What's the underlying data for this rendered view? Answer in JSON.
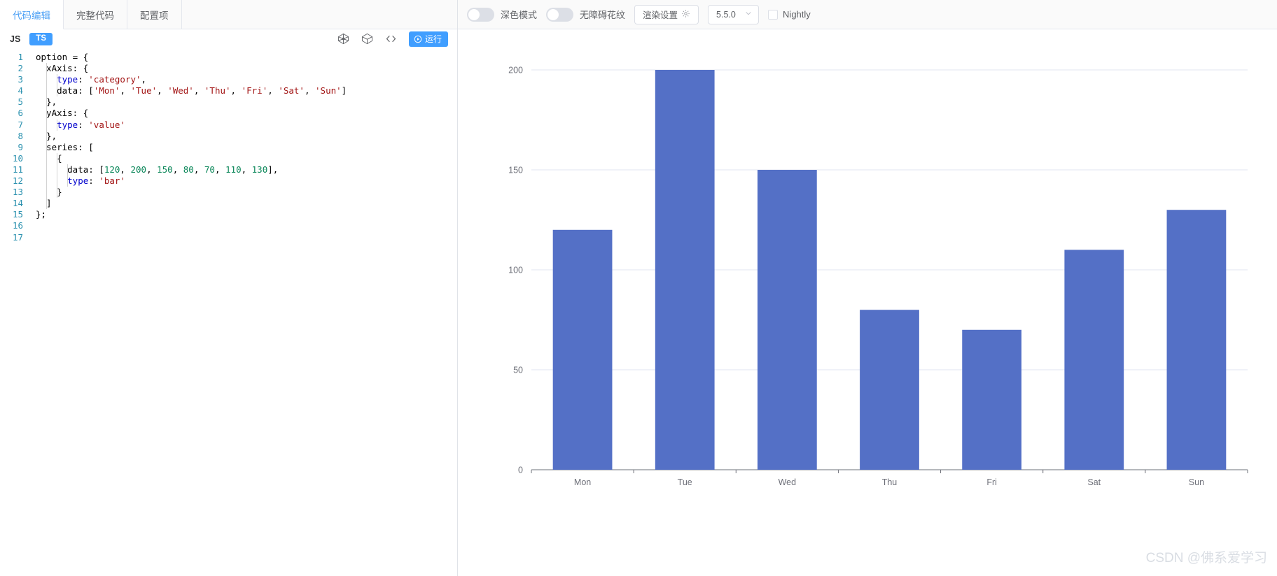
{
  "editor": {
    "tabs": [
      {
        "label": "代码编辑",
        "active": true
      },
      {
        "label": "完整代码",
        "active": false
      },
      {
        "label": "配置项",
        "active": false
      }
    ],
    "lang_js": "JS",
    "lang_ts": "TS",
    "active_lang": "TS",
    "icons": [
      "palette-icon",
      "cube-icon",
      "code-brackets-icon"
    ],
    "run_label": "运行",
    "line_count": 17,
    "line_numbers": [
      "1",
      "2",
      "3",
      "4",
      "5",
      "6",
      "7",
      "8",
      "9",
      "10",
      "11",
      "12",
      "13",
      "14",
      "15",
      "16",
      "17"
    ],
    "code_lines": [
      [
        {
          "t": "option = {",
          "c": "plain"
        }
      ],
      [
        {
          "t": "  xAxis: {",
          "c": "plain"
        }
      ],
      [
        {
          "t": "    ",
          "c": "plain"
        },
        {
          "t": "type",
          "c": "prop"
        },
        {
          "t": ": ",
          "c": "plain"
        },
        {
          "t": "'category'",
          "c": "str"
        },
        {
          "t": ",",
          "c": "plain"
        }
      ],
      [
        {
          "t": "    data: [",
          "c": "plain"
        },
        {
          "t": "'Mon'",
          "c": "str"
        },
        {
          "t": ", ",
          "c": "plain"
        },
        {
          "t": "'Tue'",
          "c": "str"
        },
        {
          "t": ", ",
          "c": "plain"
        },
        {
          "t": "'Wed'",
          "c": "str"
        },
        {
          "t": ", ",
          "c": "plain"
        },
        {
          "t": "'Thu'",
          "c": "str"
        },
        {
          "t": ", ",
          "c": "plain"
        },
        {
          "t": "'Fri'",
          "c": "str"
        },
        {
          "t": ", ",
          "c": "plain"
        },
        {
          "t": "'Sat'",
          "c": "str"
        },
        {
          "t": ", ",
          "c": "plain"
        },
        {
          "t": "'Sun'",
          "c": "str"
        },
        {
          "t": "]",
          "c": "plain"
        }
      ],
      [
        {
          "t": "  },",
          "c": "plain"
        }
      ],
      [
        {
          "t": "  yAxis: {",
          "c": "plain"
        }
      ],
      [
        {
          "t": "    ",
          "c": "plain"
        },
        {
          "t": "type",
          "c": "prop"
        },
        {
          "t": ": ",
          "c": "plain"
        },
        {
          "t": "'value'",
          "c": "str"
        }
      ],
      [
        {
          "t": "  },",
          "c": "plain"
        }
      ],
      [
        {
          "t": "  series: [",
          "c": "plain"
        }
      ],
      [
        {
          "t": "    {",
          "c": "plain"
        }
      ],
      [
        {
          "t": "      data: [",
          "c": "plain"
        },
        {
          "t": "120",
          "c": "num"
        },
        {
          "t": ", ",
          "c": "plain"
        },
        {
          "t": "200",
          "c": "num"
        },
        {
          "t": ", ",
          "c": "plain"
        },
        {
          "t": "150",
          "c": "num"
        },
        {
          "t": ", ",
          "c": "plain"
        },
        {
          "t": "80",
          "c": "num"
        },
        {
          "t": ", ",
          "c": "plain"
        },
        {
          "t": "70",
          "c": "num"
        },
        {
          "t": ", ",
          "c": "plain"
        },
        {
          "t": "110",
          "c": "num"
        },
        {
          "t": ", ",
          "c": "plain"
        },
        {
          "t": "130",
          "c": "num"
        },
        {
          "t": "],",
          "c": "plain"
        }
      ],
      [
        {
          "t": "      ",
          "c": "plain"
        },
        {
          "t": "type",
          "c": "prop"
        },
        {
          "t": ": ",
          "c": "plain"
        },
        {
          "t": "'bar'",
          "c": "str"
        }
      ],
      [
        {
          "t": "    }",
          "c": "plain"
        }
      ],
      [
        {
          "t": "  ]",
          "c": "plain"
        }
      ],
      [
        {
          "t": "};",
          "c": "plain"
        }
      ],
      [],
      []
    ]
  },
  "toolbar": {
    "dark_mode_label": "深色模式",
    "dark_mode_on": false,
    "accessibility_label": "无障碍花纹",
    "accessibility_on": false,
    "render_settings_label": "渲染设置",
    "version_value": "5.5.0",
    "nightly_label": "Nightly",
    "nightly_checked": false
  },
  "watermark": "CSDN @佛系爱学习",
  "chart_data": {
    "type": "bar",
    "title": "",
    "xlabel": "",
    "ylabel": "",
    "categories": [
      "Mon",
      "Tue",
      "Wed",
      "Thu",
      "Fri",
      "Sat",
      "Sun"
    ],
    "values": [
      120,
      200,
      150,
      80,
      70,
      110,
      130
    ],
    "series": [
      {
        "name": "",
        "values": [
          120,
          200,
          150,
          80,
          70,
          110,
          130
        ],
        "color": "#5470c6"
      }
    ],
    "ylim": [
      0,
      200
    ],
    "yticks": [
      0,
      50,
      100,
      150,
      200
    ],
    "ytick_labels": [
      "0",
      "50",
      "100",
      "150",
      "200"
    ],
    "grid": true,
    "legend": false,
    "bar_color": "#5470c6",
    "axis_color": "#6e7079",
    "gridline_color": "#e0e6f1"
  }
}
